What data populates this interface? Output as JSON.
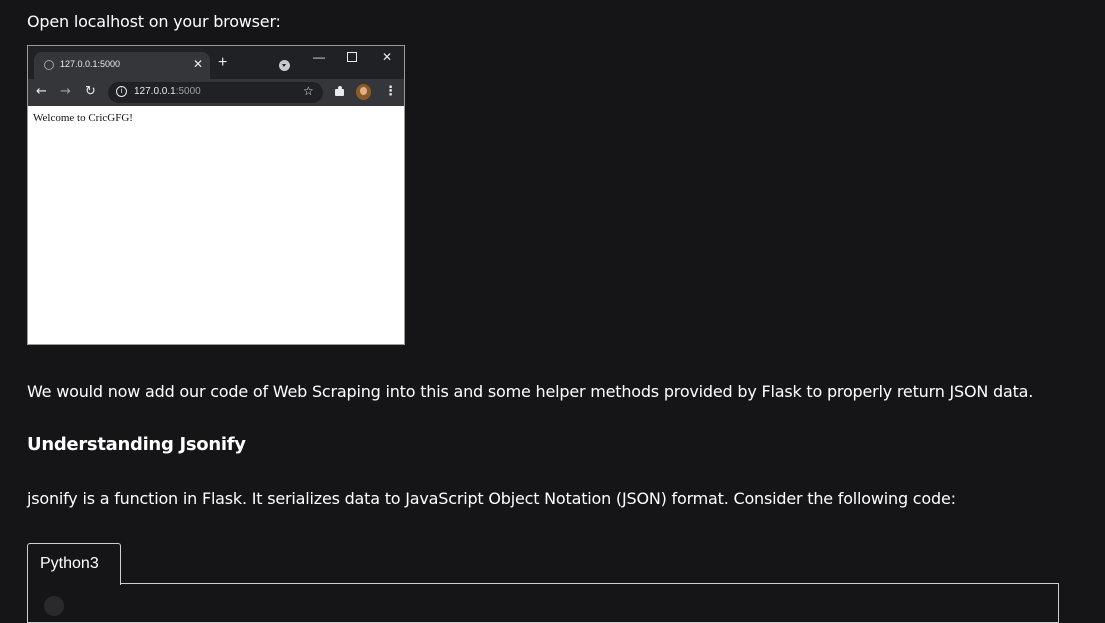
{
  "article": {
    "para_open": "Open localhost on your browser:",
    "para_add": "We would now add our code of Web Scraping into this and some helper methods provided by Flask to properly return JSON data.",
    "heading": "Understanding Jsonify",
    "para_jsonify": "jsonify is a function in Flask. It serializes data to JavaScript Object Notation (JSON) format. Consider the following code:"
  },
  "browser": {
    "tab_title": "127.0.0.1:5000",
    "url_host": "127.0.0.1",
    "url_port": ":5000",
    "page_text": "Welcome to CricGFG!",
    "icons": [
      "globe-icon",
      "close-icon",
      "plus-icon",
      "chevron-down-icon",
      "minimize-icon",
      "maximize-icon",
      "back-icon",
      "forward-icon",
      "reload-icon",
      "info-icon",
      "star-icon",
      "puzzle-icon",
      "avatar",
      "more-icon"
    ]
  },
  "code": {
    "tab_label": "Python3"
  },
  "colors": {
    "page_background": "#151517",
    "text": "#ffffff",
    "browser_chrome": "#35363a",
    "tabstrip": "#202124"
  }
}
